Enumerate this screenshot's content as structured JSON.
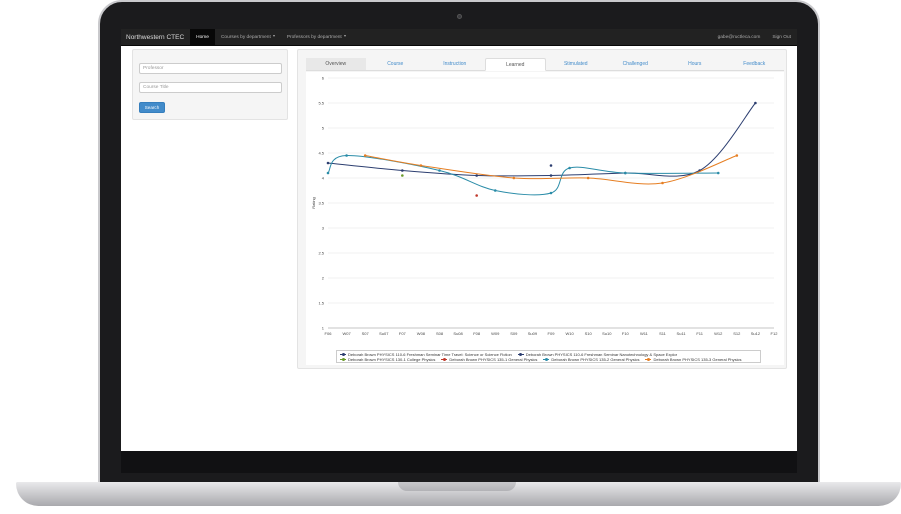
{
  "navbar": {
    "brand": "Northwestern CTEC",
    "home": "Home",
    "courses": "Courses by department",
    "professors": "Professors by department",
    "user": "gabe@ructleca.com",
    "signout": "Sign Out"
  },
  "sidebar": {
    "professor_placeholder": "Professor",
    "course_placeholder": "Course Title",
    "search_label": "Search"
  },
  "tabs": [
    "Overview",
    "Course",
    "Instruction",
    "Learned",
    "Stimulated",
    "Challenged",
    "Hours",
    "Feedback"
  ],
  "active_tab": "Learned",
  "chart_data": {
    "type": "line",
    "ylabel": "Rating",
    "xlabel": "",
    "ylim": [
      1,
      6
    ],
    "yticks": [
      1,
      1.5,
      2,
      2.5,
      3,
      3.5,
      4,
      4.5,
      5,
      5.5,
      6
    ],
    "grid": true,
    "legend_position": "bottom",
    "categories": [
      "F06",
      "W07",
      "S07",
      "Su07",
      "F07",
      "W08",
      "S08",
      "Su08",
      "F08",
      "W09",
      "S09",
      "Su09",
      "F09",
      "W10",
      "S10",
      "Su10",
      "F10",
      "W11",
      "S11",
      "Su11",
      "F11",
      "W12",
      "S12",
      "Su12",
      "F12"
    ],
    "series": [
      {
        "name": "Deborah Brown PHYSICS 110-6 Freshman Seminar Time Travel: Science or Science Fiction",
        "color": "#2c3e70",
        "values": [
          4.3,
          null,
          null,
          null,
          4.15,
          null,
          null,
          null,
          4.05,
          null,
          null,
          null,
          4.05,
          null,
          null,
          null,
          4.1,
          null,
          null,
          null,
          4.15,
          null,
          null,
          5.5,
          null
        ]
      },
      {
        "name": "Deborah Brown PHYSICS 110-6 Freshman Seminar Nanotechnology & Space Explor",
        "color": "#2c3e70",
        "values": [
          null,
          null,
          null,
          null,
          null,
          null,
          null,
          null,
          null,
          null,
          null,
          null,
          4.25,
          null,
          null,
          null,
          null,
          null,
          null,
          null,
          null,
          null,
          null,
          null,
          null
        ]
      },
      {
        "name": "Deborah Brown PHYSICS 130-1 College Physics",
        "color": "#6a9a2a",
        "values": [
          null,
          null,
          null,
          null,
          4.05,
          null,
          null,
          null,
          null,
          null,
          null,
          null,
          null,
          null,
          null,
          null,
          null,
          null,
          null,
          null,
          null,
          null,
          null,
          null,
          null
        ]
      },
      {
        "name": "Deborah Brown PHYSICS 135-1 General Physics",
        "color": "#c0392b",
        "values": [
          null,
          null,
          null,
          null,
          null,
          null,
          null,
          null,
          3.65,
          null,
          null,
          null,
          null,
          null,
          null,
          null,
          null,
          null,
          null,
          null,
          null,
          null,
          null,
          null,
          null
        ]
      },
      {
        "name": "Deborah Brown PHYSICS 135-2 General Physics",
        "color": "#2a8ca8",
        "values": [
          4.1,
          4.45,
          null,
          null,
          null,
          null,
          4.15,
          null,
          null,
          3.75,
          null,
          null,
          3.7,
          4.2,
          null,
          null,
          4.1,
          null,
          null,
          null,
          null,
          4.1,
          null,
          null,
          null
        ]
      },
      {
        "name": "Deborah Brown PHYSICS 135-3 General Physics",
        "color": "#e67e22",
        "values": [
          null,
          null,
          4.45,
          null,
          null,
          4.25,
          null,
          null,
          null,
          null,
          4.0,
          null,
          null,
          null,
          4.0,
          null,
          null,
          null,
          3.9,
          null,
          null,
          null,
          4.45,
          null,
          null
        ]
      }
    ]
  }
}
